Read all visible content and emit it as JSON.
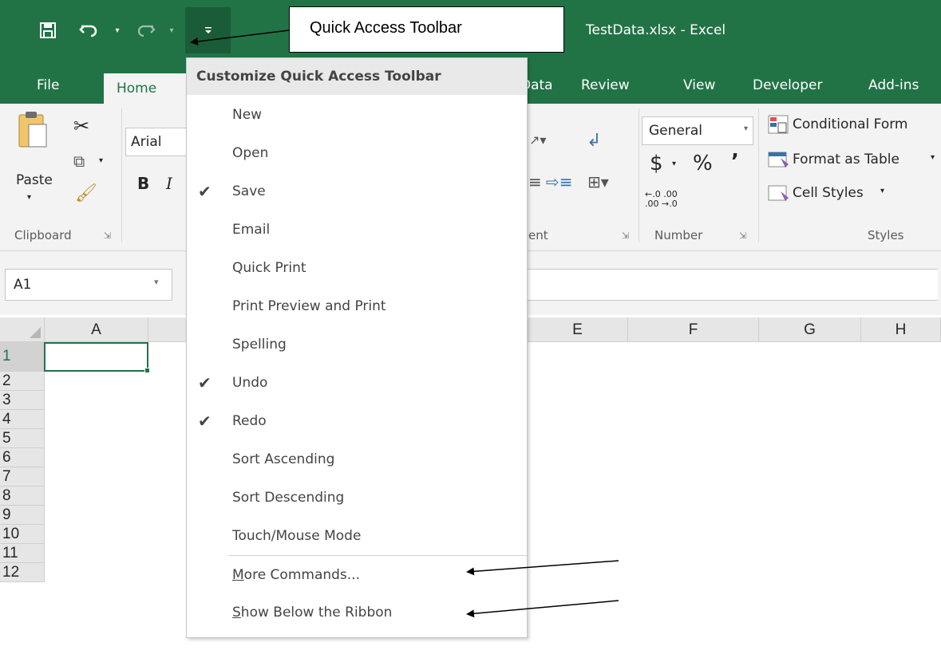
{
  "window": {
    "title": "TestData.xlsx - Excel"
  },
  "quick_access": {
    "callout_label": "Quick Access Toolbar"
  },
  "ribbon": {
    "tabs": [
      "File",
      "Home",
      "Data",
      "Review",
      "View",
      "Developer",
      "Add-ins"
    ],
    "visible_tab_fragments": {
      "data": "Data"
    },
    "clipboard": {
      "paste_label": "Paste",
      "group_label": "Clipboard"
    },
    "font": {
      "name": "Arial",
      "bold": "B",
      "italic": "I"
    },
    "alignment": {
      "group_label_fragment": "ent"
    },
    "number": {
      "format": "General",
      "currency": "$",
      "percent": "%",
      "comma": "’",
      "inc_decimal": "←.0  .00",
      "dec_decimal": ".00  →.0",
      "group_label": "Number"
    },
    "styles": {
      "conditional": "Conditional Form",
      "format_table": "Format as Table",
      "cell_styles": "Cell Styles",
      "group_label": "Styles"
    }
  },
  "formula_bar": {
    "name_box": "A1"
  },
  "grid": {
    "columns": [
      "A",
      "E",
      "F",
      "G",
      "H"
    ],
    "rows": [
      "1",
      "2",
      "3",
      "4",
      "5",
      "6",
      "7",
      "8",
      "9",
      "10",
      "11",
      "12"
    ],
    "selected_cell": "A1"
  },
  "menu": {
    "header": "Customize Quick Access Toolbar",
    "items": [
      {
        "label": "New",
        "checked": false
      },
      {
        "label": "Open",
        "checked": false
      },
      {
        "label": "Save",
        "checked": true
      },
      {
        "label": "Email",
        "checked": false
      },
      {
        "label": "Quick Print",
        "checked": false
      },
      {
        "label": "Print Preview and Print",
        "checked": false
      },
      {
        "label": "Spelling",
        "checked": false
      },
      {
        "label": "Undo",
        "checked": true
      },
      {
        "label": "Redo",
        "checked": true
      },
      {
        "label": "Sort Ascending",
        "checked": false
      },
      {
        "label": "Sort Descending",
        "checked": false
      },
      {
        "label": "Touch/Mouse Mode",
        "checked": false
      }
    ],
    "more_commands": {
      "access_key": "M",
      "rest": "ore Commands..."
    },
    "show_below": {
      "access_key": "S",
      "rest": "how Below the Ribbon"
    },
    "check_glyph": "✔"
  },
  "colors": {
    "excel_green": "#217346",
    "ribbon_bg": "#f3f3f3"
  }
}
